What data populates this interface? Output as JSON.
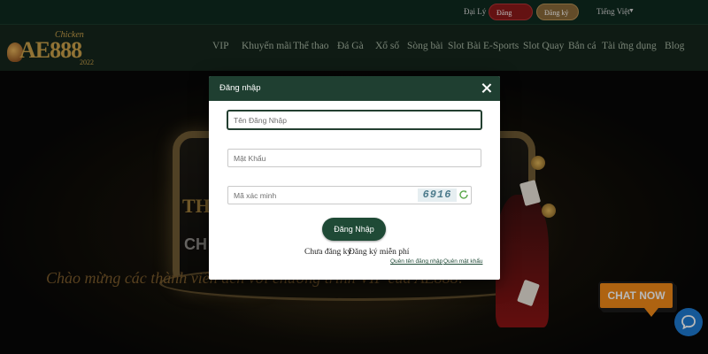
{
  "topbar": {
    "agent_label": "Đại Lý",
    "login_label": "Đăng nhập 🔒",
    "register_label": "Đăng ký 👤",
    "language_label": "Tiếng Việt"
  },
  "logo": {
    "brand": "AE888",
    "script_text": "Chicken",
    "year": "2022"
  },
  "nav": {
    "items": [
      "VIP",
      "Khuyến mãi",
      "Thể thao",
      "Đá Gà",
      "Xổ số",
      "Sòng bài",
      "Slot Bài",
      "E-Sports",
      "Slot Quay",
      "Bắn cá",
      "Tài ứng dụng",
      "Blog"
    ]
  },
  "hero": {
    "line1": "TH",
    "line2": "CH",
    "banner": "Chào mừng các thành viên đến với chương trình VIP của AE888!"
  },
  "modal": {
    "title": "Đăng nhập",
    "username_placeholder": "Tên Đăng Nhập",
    "password_placeholder": "Mật Khẩu",
    "captcha_placeholder": "Mã xác minh",
    "captcha_code": "6916",
    "submit_label": "Đăng Nhập",
    "no_account_text": "Chưa đăng ký",
    "register_link": "Đăng ký miễn phí",
    "forgot_username": "Quên tên đăng nhập",
    "forgot_password": "Quên mật khẩu"
  },
  "chat": {
    "label": "CHAT NOW"
  },
  "colors": {
    "header_green": "#1f3f31",
    "accent_gold": "#c9a04a",
    "chat_orange": "#f18a18",
    "chat_blue": "#1e7ad1"
  }
}
